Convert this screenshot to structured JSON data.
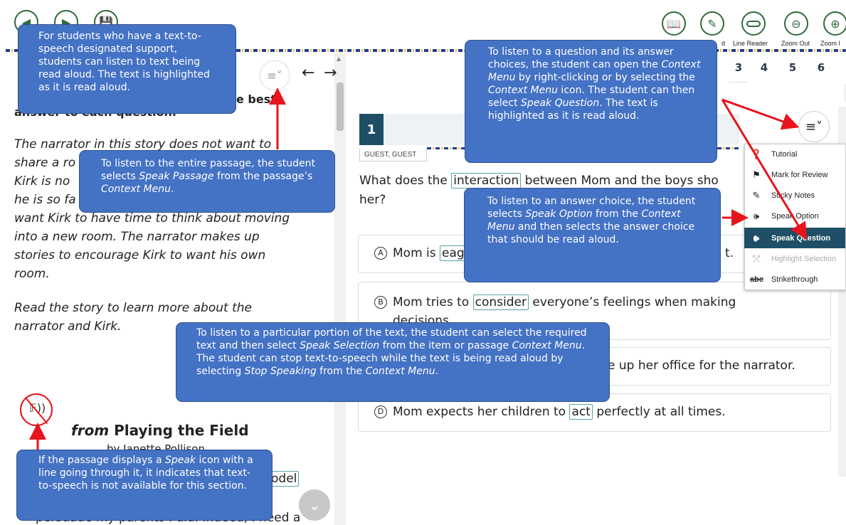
{
  "toolbar": {
    "left_buttons": [
      "back-icon",
      "forward-icon",
      "save-icon"
    ],
    "right_tools": [
      {
        "icon": "book-icon",
        "label": ""
      },
      {
        "icon": "notepad-icon",
        "label": "d"
      },
      {
        "icon": "line-reader-icon",
        "label": "Line Reader"
      },
      {
        "icon": "zoom-out-icon",
        "label": "Zoom Out"
      },
      {
        "icon": "zoom-in-icon",
        "label": "Zoom I"
      }
    ]
  },
  "question_nav": [
    "3",
    "4",
    "5",
    "6"
  ],
  "passage": {
    "instruction": "answer to each question.",
    "instruction_tail": "e best",
    "intro_lines": [
      "The narrator in this story does not want to",
      "share a ro",
      "Kirk is no",
      "he is so fa",
      "want Kirk to have time to think about moving",
      "into a new room. The narrator makes up",
      "stories to encourage Kirk to want his own",
      "room."
    ],
    "read_lines": [
      "Read the story to learn more about the",
      "narrator and Kirk."
    ],
    "title_from": "from",
    "title_main": "Playing the Field",
    "byline": "by Janette Pollison",
    "model_word": "odel",
    "bottom_line": "persuade my parents I did. Indeed, I need a"
  },
  "item": {
    "number": "1",
    "user": "GUEST, GUEST",
    "question_line1_a": "What does the ",
    "question_word": "interaction",
    "question_line1_b": " between Mom and the boys sho",
    "question_line2": "her?",
    "options": [
      {
        "letter": "A",
        "pre": "Mom is ",
        "word": "eag",
        "post": "",
        "tail": "t."
      },
      {
        "letter": "B",
        "pre": "Mom tries to ",
        "word": "consider",
        "post": " everyone’s feelings when making",
        "line2": "decisions."
      },
      {
        "letter": "C",
        "pre": "",
        "word": "",
        "post": "",
        "tail": "e up her office for the narrator."
      },
      {
        "letter": "D",
        "pre": "Mom expects her children to ",
        "word": "act",
        "post": " perfectly at all times."
      }
    ]
  },
  "context_menu": [
    {
      "icon": "info-icon",
      "label": "Tutorial",
      "state": "normal"
    },
    {
      "icon": "flag-icon",
      "label": "Mark for Review",
      "state": "normal"
    },
    {
      "icon": "sticky-note-icon",
      "label": "Sticky Notes",
      "state": "normal"
    },
    {
      "icon": "speaker-icon",
      "label": "Speak Option",
      "state": "normal"
    },
    {
      "icon": "speaker-icon",
      "label": "Speak Question",
      "state": "selected"
    },
    {
      "icon": "highlighter-icon",
      "label": "Highlight Selection",
      "state": "disabled"
    },
    {
      "icon": "strikethrough-icon",
      "label": "Strikethrough",
      "state": "normal"
    }
  ],
  "callouts": {
    "tts_support": "For students who have a text-to-speech designated support, students can listen to text being read aloud. The text is highlighted as it is read aloud.",
    "speak_passage": [
      "To listen to the entire passage, the student selects ",
      "Speak Passage",
      " from the passage’s ",
      "Context Menu",
      "."
    ],
    "speak_question": [
      "To listen to a question and its answer choices, the student can open the ",
      "Context Menu",
      " by right-clicking or by selecting the ",
      "Context Menu",
      " icon. The student can then select ",
      "Speak Question",
      ". The text is highlighted as it is read aloud."
    ],
    "speak_option": [
      "To listen to an answer choice, the student selects ",
      "Speak Option",
      " from the ",
      "Context Menu",
      " and then selects the answer choice that should be read aloud."
    ],
    "speak_selection": [
      "To listen to a particular portion of the text, the student can select the required text and then select ",
      "Speak Selection",
      " from the item or passage ",
      "Context Menu",
      ". The student can stop text-to-speech while the text is being read aloud by selecting ",
      "Stop Speaking",
      " from the ",
      "Context Menu",
      "."
    ],
    "speak_disabled": [
      "If the passage  displays a ",
      "Speak",
      " icon with a line going through it, it indicates that text-to-speech is not available for this section."
    ]
  },
  "colors": {
    "callout_bg": "#4472c4",
    "arrow": "#e8141b",
    "accent_teal": "#1e4f66",
    "menu_selected": "#1e4f66",
    "tool_green": "#2f6b3a"
  }
}
